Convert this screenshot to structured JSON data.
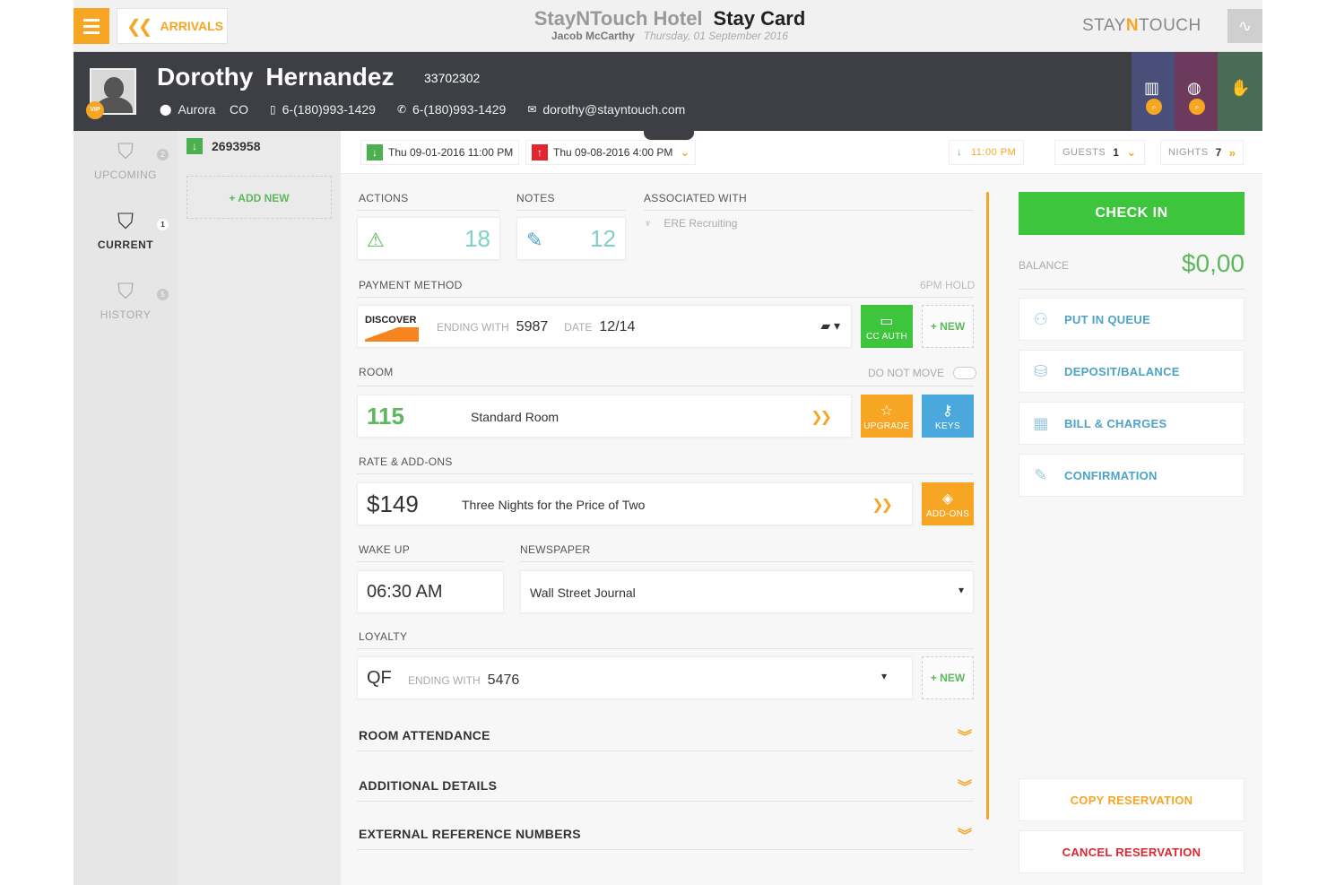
{
  "topbar": {
    "back_label": "ARRIVALS",
    "hotel_name": "StayNTouch Hotel",
    "screen_title": "Stay Card",
    "user": "Jacob McCarthy",
    "date": "Thursday, 01 September 2016",
    "brand_pre": "STAY",
    "brand_n": "N",
    "brand_post": "TOUCH",
    "icons": {
      "menu": "hamburger-icon",
      "back": "double-chevron-left-icon",
      "pulse": "activity-icon"
    }
  },
  "guest": {
    "first_name": "Dorothy",
    "last_name": "Hernandez",
    "id": "33702302",
    "vip_badge": "VIP",
    "city": "Aurora",
    "state": "CO",
    "mobile": "6-(180)993-1429",
    "phone": "6-(180)993-1429",
    "email": "dorothy@stayntouch.com",
    "tiles": [
      {
        "color": "#4a4f7a",
        "icon": "building-icon"
      },
      {
        "color": "#6b3a5c",
        "icon": "globe-icon"
      },
      {
        "color": "#4a6b55",
        "icon": "handshake-icon"
      }
    ]
  },
  "nav": {
    "items": [
      {
        "label": "UPCOMING",
        "count": "2"
      },
      {
        "label": "CURRENT",
        "count": "1"
      },
      {
        "label": "HISTORY",
        "count": "5"
      }
    ]
  },
  "reservations": {
    "number": "2693958",
    "add_new": "+ ADD NEW"
  },
  "dates": {
    "arrival": "Thu 09-01-2016 11:00 PM",
    "departure": "Thu 09-08-2016 4:00 PM",
    "arrival_time": "11:00 PM",
    "guests_label": "GUESTS",
    "guests": "1",
    "nights_label": "NIGHTS",
    "nights": "7"
  },
  "sections": {
    "actions_label": "ACTIONS",
    "actions_count": "18",
    "notes_label": "NOTES",
    "notes_count": "12",
    "associated_label": "ASSOCIATED WITH",
    "associated_value": "ERE Recruiting",
    "payment_label": "PAYMENT METHOD",
    "hold_label": "6PM HOLD",
    "card_brand": "DISCOVER",
    "ending_label": "ENDING WITH",
    "ending_value": "5987",
    "date_label": "DATE",
    "date_value": "12/14",
    "cc_auth": "CC AUTH",
    "new_label": "+ NEW",
    "room_label": "ROOM",
    "do_not_move": "DO NOT MOVE",
    "room_number": "115",
    "room_type": "Standard Room",
    "upgrade": "UPGRADE",
    "keys": "KEYS",
    "rate_label": "RATE & ADD-ONS",
    "rate_amount": "$149",
    "rate_name": "Three Nights for the Price of Two",
    "addons": "ADD-ONS",
    "wakeup_label": "WAKE UP",
    "wakeup_value": "06:30 AM",
    "newspaper_label": "NEWSPAPER",
    "newspaper_value": "Wall Street Journal",
    "loyalty_label": "LOYALTY",
    "loyalty_code": "QF",
    "loyalty_ending_label": "ENDING WITH",
    "loyalty_ending_value": "5476",
    "room_attendance": "ROOM ATTENDANCE",
    "additional_details": "ADDITIONAL DETAILS",
    "external_refs": "EXTERNAL REFERENCE NUMBERS"
  },
  "right": {
    "check_in": "CHECK IN",
    "balance_label": "BALANCE",
    "balance_value": "$0,00",
    "put_in_queue": "PUT IN QUEUE",
    "deposit_balance": "DEPOSIT/BALANCE",
    "bill_charges": "BILL & CHARGES",
    "confirmation": "CONFIRMATION",
    "copy_reservation": "COPY RESERVATION",
    "cancel_reservation": "CANCEL RESERVATION"
  },
  "colors": {
    "accent": "#f6a623",
    "success": "#3dc53d",
    "header": "#3d3f45",
    "link": "#4da3c7",
    "danger": "#e0262f",
    "copy": "#f6a623",
    "upgrade": "#f6a623",
    "keys": "#4aa8dd",
    "cc_auth": "#3dc53d"
  }
}
